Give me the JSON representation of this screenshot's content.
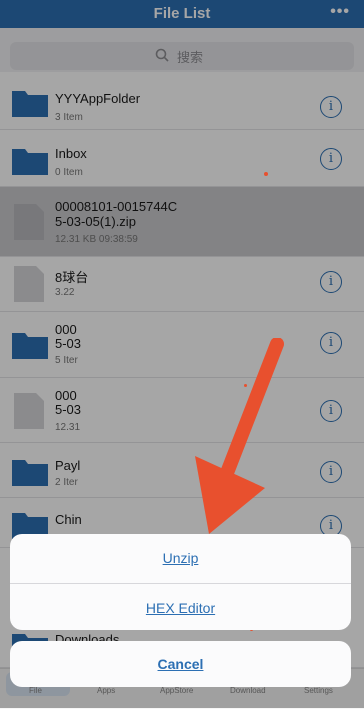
{
  "nav": {
    "title": "File List",
    "more": "•••"
  },
  "search": {
    "placeholder": "搜索"
  },
  "rows": [
    {
      "name": "YYYAppFolder",
      "sub": "3 Item",
      "type": "folder"
    },
    {
      "name": "Inbox",
      "sub": "0 Item",
      "type": "folder"
    },
    {
      "name1": "00008101-0015744C",
      "name2": "5-03-05(1).zip",
      "sub": "12.31 KB   09:38:59",
      "type": "file"
    },
    {
      "name": "8球台",
      "sub": "3.22",
      "type": "file"
    },
    {
      "name1": "000",
      "name2": "5-03",
      "sub": "5 Iter",
      "type": "folder"
    },
    {
      "name1": "000",
      "name2": "5-03",
      "sub": "12.31",
      "type": "file"
    },
    {
      "name": "Payl",
      "sub": "2 Iter",
      "type": "folder"
    },
    {
      "name": "Chin",
      "sub": "",
      "type": "folder"
    },
    {
      "name": "Downloads",
      "sub": "",
      "type": "folder"
    }
  ],
  "sheet": {
    "unzip": "Unzip",
    "hex": "HEX Editor",
    "cancel": "Cancel"
  },
  "tabs": [
    "File",
    "Apps",
    "AppStore",
    "Download",
    "Settings"
  ],
  "colors": {
    "accent": "#2c6fb3",
    "arrow": "#e8502e"
  }
}
